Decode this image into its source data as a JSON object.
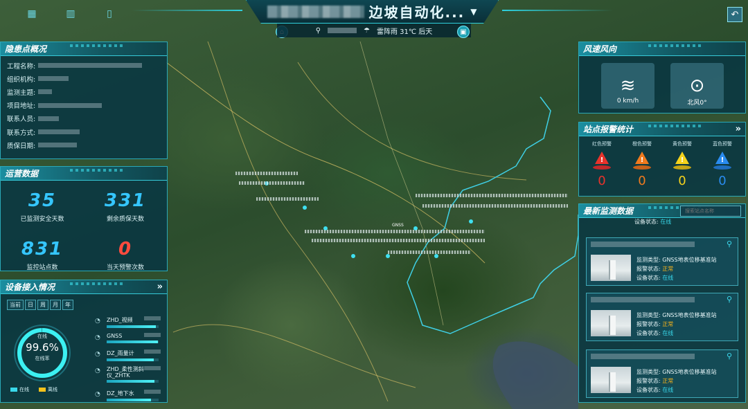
{
  "header": {
    "title": "边坡自动化...",
    "title_arrow": "▼",
    "weather": "雷阵雨 31℃ 后天",
    "back_icon": "back-arrow-icon"
  },
  "overview": {
    "title": "隐患点概况",
    "rows": [
      {
        "label": "工程名称:"
      },
      {
        "label": "组织机构:"
      },
      {
        "label": "监测主题:"
      },
      {
        "label": "项目地址:"
      },
      {
        "label": "联系人员:"
      },
      {
        "label": "联系方式:"
      },
      {
        "label": "质保日期:"
      }
    ]
  },
  "operations": {
    "title": "运营数据",
    "stats": [
      {
        "value": "35",
        "label": "已监测安全天数",
        "color": "#35c6ff"
      },
      {
        "value": "331",
        "label": "剩余质保天数",
        "color": "#35c6ff"
      },
      {
        "value": "831",
        "label": "监控站点数",
        "color": "#35c6ff"
      },
      {
        "value": "0",
        "label": "当天预警次数",
        "color": "#ff4b3e"
      }
    ]
  },
  "devices": {
    "title": "设备接入情况",
    "tabs": [
      "当前",
      "日",
      "周",
      "月",
      "年"
    ],
    "ring_value": "99.6%",
    "ring_fraction": 0.996,
    "ring_sub": "在线率",
    "ring_top": "在线",
    "legend_online": "在线",
    "legend_offline": "离线",
    "items": [
      {
        "name": "ZHD_视频",
        "fill": 0.95
      },
      {
        "name": "GNSS",
        "fill": 0.98
      },
      {
        "name": "DZ_雨量计",
        "fill": 0.9
      },
      {
        "name": "ZHD_柔性测斜仪_ZHTK",
        "fill": 0.92
      },
      {
        "name": "DZ_地下水",
        "fill": 0.85
      }
    ]
  },
  "wind": {
    "title": "风速风向",
    "speed": "0 km/h",
    "direction": "北风0°"
  },
  "alarms": {
    "title": "站点报警统计",
    "levels": [
      {
        "name": "红色预警",
        "count": "0",
        "color": "#e8332b"
      },
      {
        "name": "橙色预警",
        "count": "0",
        "color": "#f07a1e"
      },
      {
        "name": "黄色预警",
        "count": "0",
        "color": "#f5d21c"
      },
      {
        "name": "蓝色预警",
        "count": "0",
        "color": "#2a8cf0"
      }
    ]
  },
  "latest": {
    "title": "最新监测数据",
    "search_placeholder": "搜索站点名称",
    "partial_status_label": "设备状态:",
    "partial_status_value": "在线",
    "cards": [
      {
        "type_label": "监测类型:",
        "type_value": "GNSS地表位移基准站",
        "alarm_label": "报警状态:",
        "alarm_value": "正常",
        "status_label": "设备状态:",
        "status_value": "在线"
      },
      {
        "type_label": "监测类型:",
        "type_value": "GNSS地表位移基准站",
        "alarm_label": "报警状态:",
        "alarm_value": "正常",
        "status_label": "设备状态:",
        "status_value": "在线"
      },
      {
        "type_label": "监测类型:",
        "type_value": "GNSS地表位移基准站",
        "alarm_label": "报警状态:",
        "alarm_value": "正常",
        "status_label": "设备状态:",
        "status_value": "在线"
      }
    ]
  },
  "map": {
    "labels": [
      "GNSS"
    ]
  },
  "colors": {
    "accent": "#2fd3e0",
    "panel_bg": "#093742",
    "online": "#39d8ea",
    "offline": "#f5c21b"
  }
}
